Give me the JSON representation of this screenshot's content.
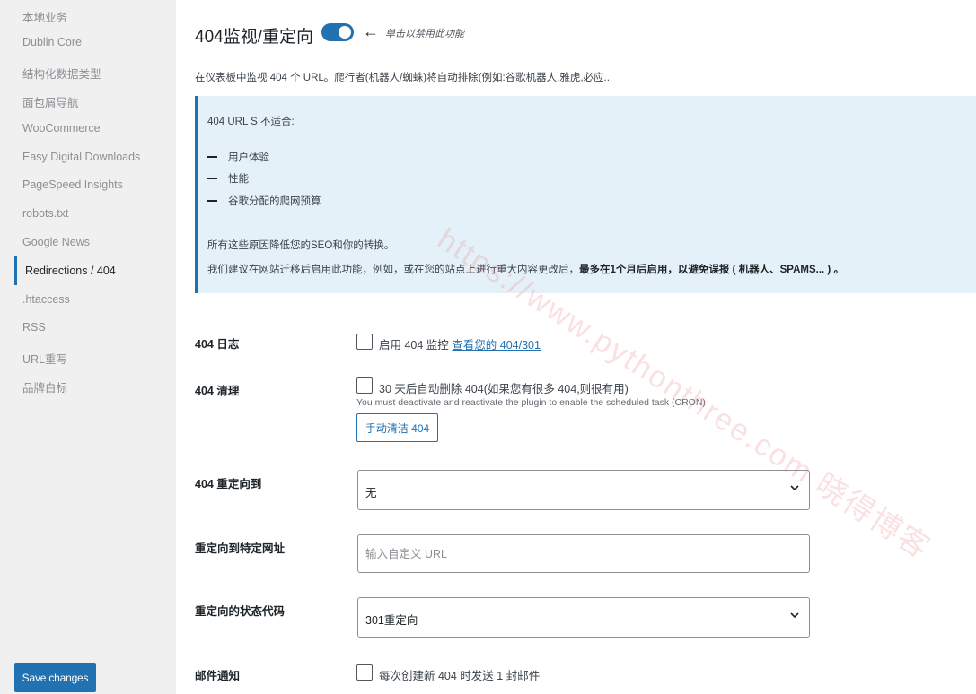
{
  "sidebar": {
    "items": [
      {
        "label": "本地业务"
      },
      {
        "label": "Dublin Core"
      },
      {
        "label": "结构化数据类型"
      },
      {
        "label": "面包屑导航"
      },
      {
        "label": "WooCommerce"
      },
      {
        "label": "Easy Digital Downloads"
      },
      {
        "label": "PageSpeed Insights"
      },
      {
        "label": "robots.txt"
      },
      {
        "label": "Google News"
      },
      {
        "label": "Redirections / 404",
        "active": true
      },
      {
        "label": ".htaccess"
      },
      {
        "label": "RSS"
      },
      {
        "label": "URL重写"
      },
      {
        "label": "品牌白标"
      }
    ],
    "save_label": "Save changes"
  },
  "header": {
    "title": "404监视/重定向",
    "toggle_on": true,
    "toggle_hint": "单击以禁用此功能",
    "description": "在仪表板中监视 404 个 URL。爬行者(机器人/蜘蛛)将自动排除(例如:谷歌机器人,雅虎,必应..."
  },
  "notice": {
    "heading": "404 URL S 不适合:",
    "items": [
      "用户体验",
      "性能",
      "谷歌分配的爬网预算"
    ],
    "p1": "所有这些原因降低您的SEO和你的转换。",
    "p2_normal": "我们建议在网站迁移后启用此功能，例如，或在您的站点上进行重大内容更改后，",
    "p2_bold": "最多在1个月后启用，以避免误报 ( 机器人、SPAMS... ) 。"
  },
  "form": {
    "log": {
      "label": "404 日志",
      "checkbox_text": "启用 404 监控",
      "link": "查看您的 404/301",
      "checked": false
    },
    "cleanup": {
      "label": "404 清理",
      "checkbox_text": "30 天后自动删除 404(如果您有很多 404,则很有用)",
      "hint": "You must deactivate and reactivate the plugin to enable the scheduled task (CRON)",
      "button": "手动清洁 404",
      "checked": false
    },
    "redirect_to": {
      "label": "404 重定向到",
      "value": "无"
    },
    "custom_url": {
      "label": "重定向到特定网址",
      "placeholder": "输入自定义 URL",
      "value": ""
    },
    "status_code": {
      "label": "重定向的状态代码",
      "value": "301重定向"
    },
    "email": {
      "label": "邮件通知",
      "checkbox_text": "每次创建新 404 时发送 1 封邮件",
      "checked": false
    }
  },
  "watermark": "https://www.pythonthree.com 晓得博客",
  "colors": {
    "accent": "#2271b1",
    "notice_bg": "#e5f1f8",
    "sidebar_bg": "#f0f0f1"
  }
}
